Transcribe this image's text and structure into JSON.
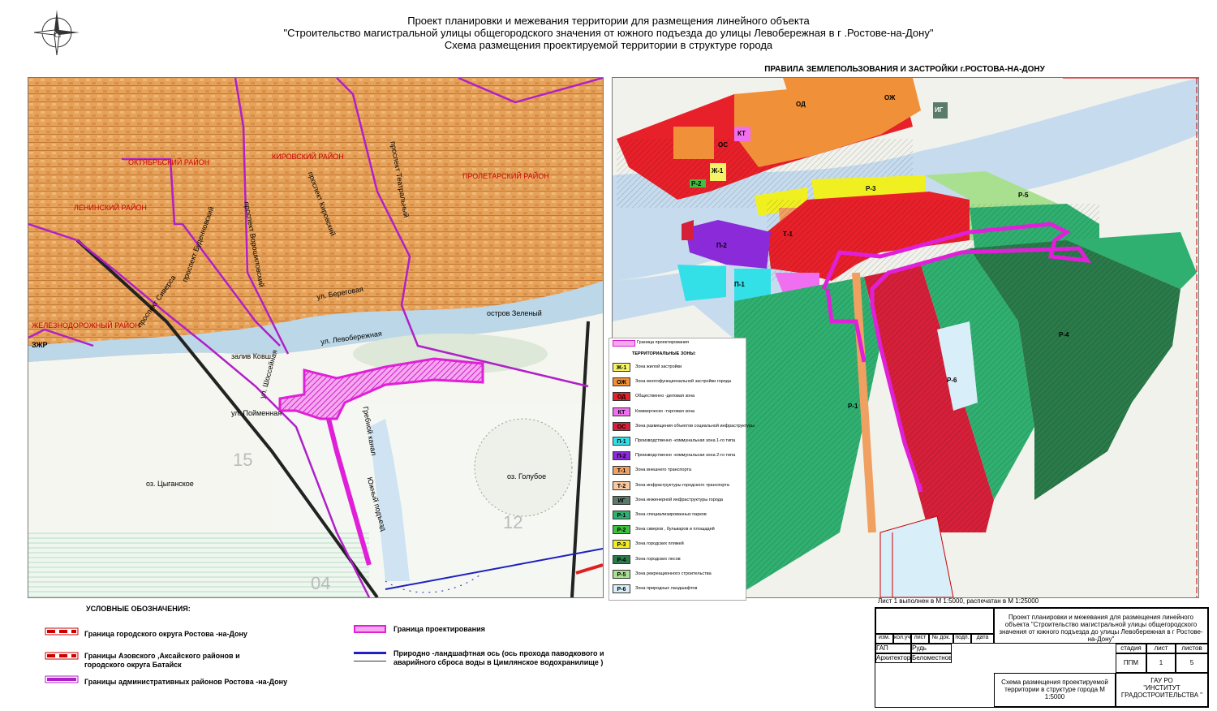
{
  "header": {
    "line1": "Проект планировки и межевания территории для размещения линейного объекта",
    "line2": "\"Строительство магистральной улицы общегородского значения от южного подъезда до улицы Левобережная в г   .Ростове-на-Дону\"",
    "line3": "Схема размещения проектируемой территории в структуре города"
  },
  "left_map": {
    "districts": [
      "ОКТЯБРЬСКИЙ РАЙОН",
      "ЛЕНИНСКИЙ РАЙОН",
      "КИРОВСКИЙ РАЙОН",
      "ПРОЛЕТАРСКИЙ РАЙОН",
      "ЖЕЛЕЗНОДОРОЖНЫЙ РАЙОН"
    ],
    "streets": [
      "проспект Буденновский",
      "проспект Ворошиловский",
      "проспект Кировский",
      "проспект Театральный",
      "ул. Береговая",
      "проспект Сиверса",
      "ул. Левобережная",
      "залив Ковш",
      "ул. Шоссейная",
      "ул. Пойменная",
      "Гребной канал",
      "Южный подъезд",
      "остров Зеленый",
      "оз. Цыганское",
      "оз. Голубое",
      "ЗЖР"
    ],
    "numbers": [
      "15",
      "12",
      "04",
      "15",
      "04"
    ]
  },
  "right_map": {
    "title": "ПРАВИЛА ЗЕМЛЕПОЛЬЗОВАНИЯ И ЗАСТРОЙКИ г.РОСТОВА-НА-ДОНУ",
    "zone_labels": [
      "ОЖ",
      "ОД",
      "ИГ",
      "КТ",
      "Ж-1",
      "ОС",
      "Р-2",
      "Р-3",
      "Р-5",
      "Т-1",
      "П-1",
      "П-2",
      "Р-1",
      "Р-4",
      "Р-6"
    ],
    "legend": {
      "boundary": "Граница проектирования",
      "zones_title": "ТЕРРИТОРИАЛЬНЫЕ ЗОНЫ:",
      "items": [
        {
          "code": "Ж-1",
          "color": "#f4f466",
          "text": "Зона жилой застройки"
        },
        {
          "code": "ОЖ",
          "color": "#f0913a",
          "text": "Зона многофункциональной застройки города"
        },
        {
          "code": "ОД",
          "color": "#e8202a",
          "text": "Общественно -деловая зона"
        },
        {
          "code": "КТ",
          "color": "#f06ef0",
          "text": "Коммерческо -торговая зона"
        },
        {
          "code": "ОС",
          "color": "#d6203a",
          "text": "Зона размещения объектов социальной инфраструктуры"
        },
        {
          "code": "П-1",
          "color": "#34e0e8",
          "text": "Производственно -коммунальная зона  1-го типа"
        },
        {
          "code": "П-2",
          "color": "#8a2ad8",
          "text": "Производственно -коммунальная зона  2-го типа"
        },
        {
          "code": "Т-1",
          "color": "#f0a060",
          "text": "Зона внешнего транспорта"
        },
        {
          "code": "Т-2",
          "color": "#f8c8a0",
          "text": "Зона инфраструктуры городского транспорта"
        },
        {
          "code": "ИГ",
          "color": "#5a7a6a",
          "text": "Зона инженерной инфраструктуры города"
        },
        {
          "code": "Р-1",
          "color": "#30b070",
          "text": "Зона специализированных парков"
        },
        {
          "code": "Р-2",
          "color": "#40c040",
          "text": "Зона скверов , бульваров и площадей"
        },
        {
          "code": "Р-3",
          "color": "#f0f020",
          "text": "Зона городских пляжей"
        },
        {
          "code": "Р-4",
          "color": "#2a7a4a",
          "text": "Зона городских лесов"
        },
        {
          "code": "Р-5",
          "color": "#a8e090",
          "text": "Зона рекреационного строительства"
        },
        {
          "code": "Р-6",
          "color": "#d8eef8",
          "text": "Зона природных ландшафтов"
        }
      ]
    }
  },
  "legend_bottom": {
    "title": "УСЛОВНЫЕ ОБОЗНАЧЕНИЯ:",
    "items": [
      "Граница городского округа Ростова  -на-Дону",
      "Границы Азовского ,Аксайского районов и",
      "городского округа Батайск",
      "Границы административных районов Ростова  -на-Дону",
      "Граница проектирования",
      "Природно -ландшафтная ось  (ось прохода паводкового и",
      "аварийного сброса воды в Цимлянское водохранилище  )"
    ]
  },
  "stamp": {
    "scale_note": "Лист 1 выполнен в М 1:5000, распечатан в М 1:25000",
    "headers": [
      "изм.",
      "кол.уч",
      "лист",
      "№ док.",
      "подп.",
      "дата"
    ],
    "roles": [
      {
        "role": "ГАП",
        "name": "Рудь"
      },
      {
        "role": "Архитектор",
        "name": "Беломестнова"
      }
    ],
    "project": "Проект планировки и межевания для размещения линейного объекта \"Строительство магистральной улицы общегородского значения от южного подъезда до улицы Левобережная в г   Ростове-на-Дону\"",
    "stage_label": "стадия",
    "sheet_label": "лист",
    "sheets_label": "листов",
    "stage": "ППМ",
    "sheet": "1",
    "sheets": "5",
    "drawing_title": "Схема размещения проектируемой территории в структуре города М 1:5000",
    "org1": "ГАУ РО",
    "org2": "\"ИНСТИТУТ",
    "org3": "ГРАДОСТРОИТЕЛЬСТВА \""
  }
}
